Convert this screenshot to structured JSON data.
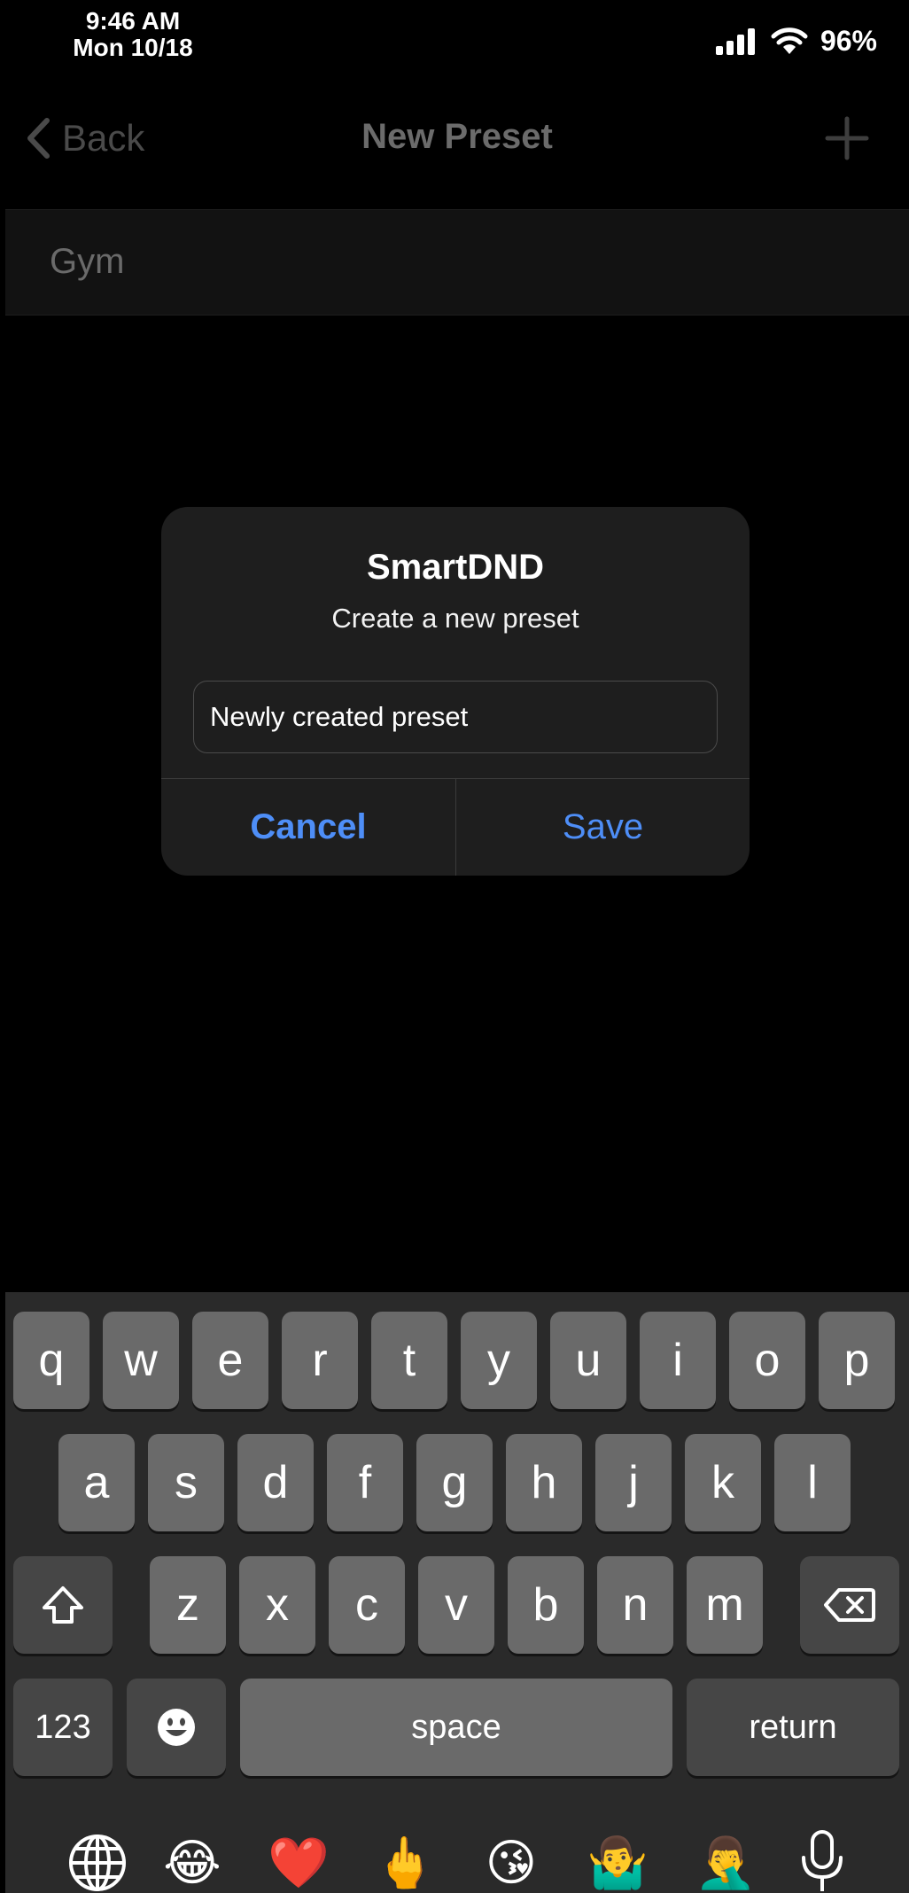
{
  "status_bar": {
    "time": "9:46 AM",
    "date": "Mon 10/18",
    "battery": "96%"
  },
  "navbar": {
    "back_label": "Back",
    "title": "New Preset"
  },
  "list": {
    "items": [
      "Gym"
    ]
  },
  "alert": {
    "title": "SmartDND",
    "message": "Create a new preset",
    "input_value": "Newly created preset",
    "cancel_label": "Cancel",
    "save_label": "Save"
  },
  "keyboard": {
    "row1": [
      "q",
      "w",
      "e",
      "r",
      "t",
      "y",
      "u",
      "i",
      "o",
      "p"
    ],
    "row2": [
      "a",
      "s",
      "d",
      "f",
      "g",
      "h",
      "j",
      "k",
      "l"
    ],
    "row3": [
      "z",
      "x",
      "c",
      "v",
      "b",
      "n",
      "m"
    ],
    "numbers_label": "123",
    "space_label": "space",
    "return_label": "return",
    "emoji_suggestions": [
      "😂",
      "❤️",
      "🖕",
      "😘",
      "🤷‍♂️",
      "🤦‍♂️"
    ]
  },
  "colors": {
    "accent": "#4e8ef7",
    "alert_bg": "#1e1e1e",
    "keyboard_bg": "#2a2a2a",
    "key_light": "#6a6a6a",
    "key_dark": "#464646"
  }
}
